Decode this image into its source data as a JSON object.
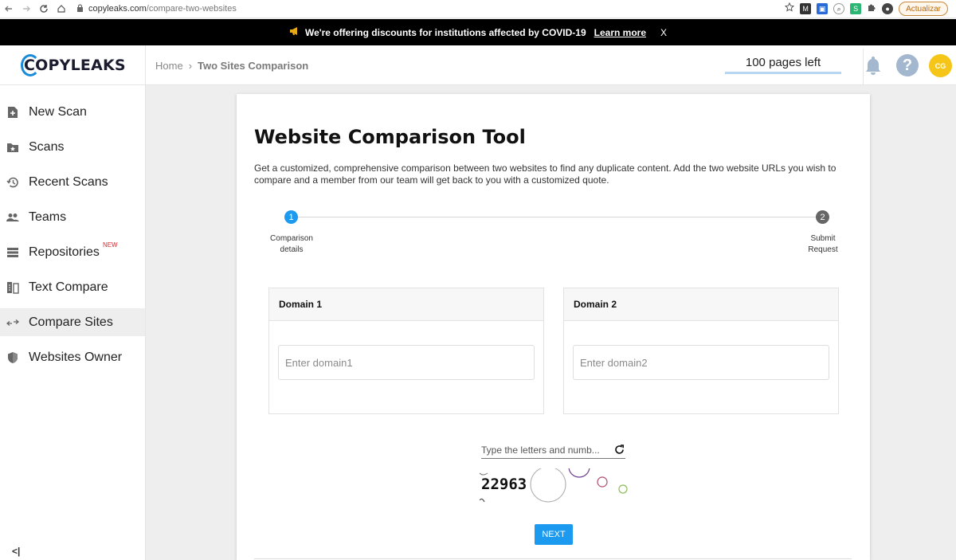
{
  "browser": {
    "url_domain": "copyleaks.com",
    "url_path": "/compare-two-websites",
    "update_label": "Actualizar"
  },
  "announcement": {
    "text": "We're offering discounts for institutions affected by COVID-19",
    "link": "Learn more",
    "close": "X"
  },
  "header": {
    "logo_first": "C",
    "logo_rest": "OPYLEAKS",
    "breadcrumb": {
      "home": "Home",
      "separator": "›",
      "current": "Two Sites Comparison"
    },
    "pages_left": "100 pages left",
    "help_glyph": "?",
    "avatar_initials": "CG"
  },
  "sidebar": {
    "items": [
      {
        "label": "New Scan",
        "icon": "new-scan-icon"
      },
      {
        "label": "Scans",
        "icon": "scans-folder-icon"
      },
      {
        "label": "Recent Scans",
        "icon": "history-icon"
      },
      {
        "label": "Teams",
        "icon": "teams-icon"
      },
      {
        "label": "Repositories",
        "icon": "repositories-icon",
        "badge": "NEW"
      },
      {
        "label": "Text Compare",
        "icon": "text-compare-icon"
      },
      {
        "label": "Compare Sites",
        "icon": "compare-sites-icon",
        "active": true
      },
      {
        "label": "Websites Owner",
        "icon": "shield-icon"
      }
    ],
    "collapse_label": "<|"
  },
  "main": {
    "title": "Website Comparison Tool",
    "description": "Get a customized, comprehensive comparison between two websites to find any duplicate content. Add the two website URLs you wish to compare and a member from our team will get back to you with a customized quote.",
    "steps": [
      {
        "number": "1",
        "label_line1": "Comparison",
        "label_line2": "details"
      },
      {
        "number": "2",
        "label_line1": "Submit",
        "label_line2": "Request"
      }
    ],
    "domain1": {
      "title": "Domain 1",
      "placeholder": "Enter domain1"
    },
    "domain2": {
      "title": "Domain 2",
      "placeholder": "Enter domain2"
    },
    "captcha": {
      "placeholder": "Type the letters and numb...",
      "code": "22963"
    },
    "next_label": "NEXT"
  },
  "colors": {
    "accent": "#1b9aef",
    "logo_ring": "#1a8bd8",
    "avatar": "#f5c518",
    "announcement_bg": "#000000",
    "new_badge": "#e0262b"
  }
}
